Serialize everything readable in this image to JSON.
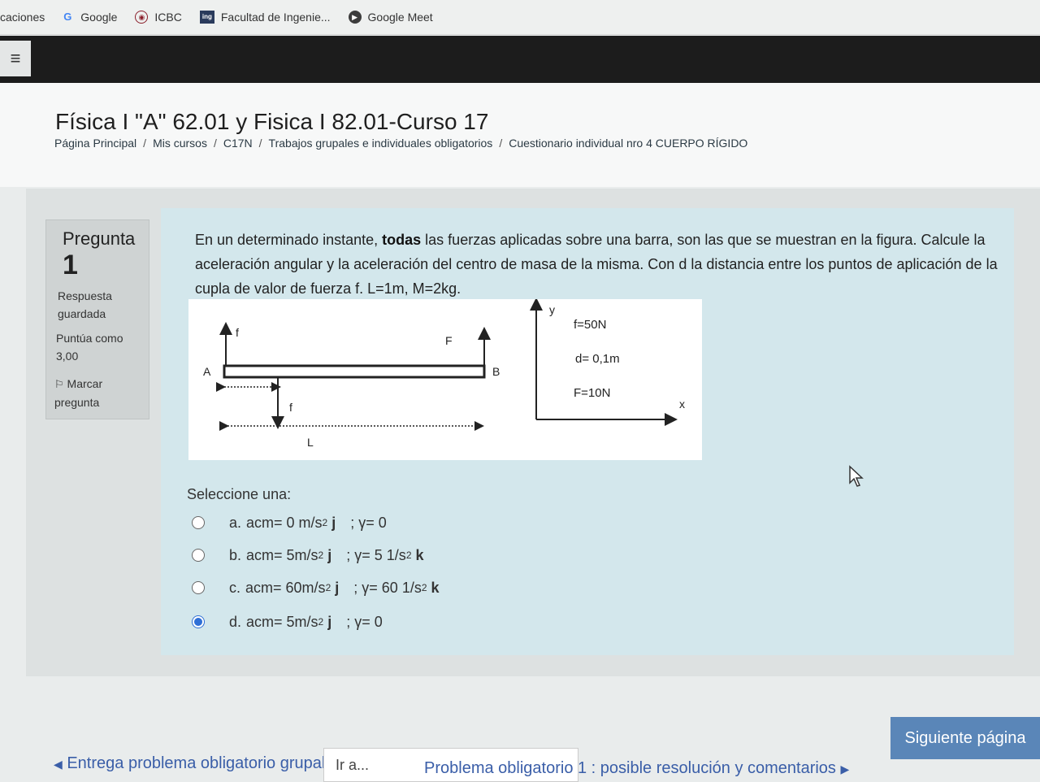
{
  "bookmarks": [
    {
      "label": "caciones",
      "icon": ""
    },
    {
      "label": "Google",
      "icon": "google-icon"
    },
    {
      "label": "ICBC",
      "icon": "icbc-icon"
    },
    {
      "label": "Facultad de Ingenie...",
      "icon": "ing-icon"
    },
    {
      "label": "Google Meet",
      "icon": "meet-icon"
    }
  ],
  "header": {
    "course_title": "Física I \"A\" 62.01 y Fisica I 82.01-Curso 17",
    "breadcrumb": [
      "Página Principal",
      "Mis cursos",
      "C17N",
      "Trabajos grupales e individuales obligatorios",
      "Cuestionario individual nro 4 CUERPO RÍGIDO"
    ]
  },
  "question_info": {
    "label": "Pregunta",
    "number": "1",
    "state_line1": "Respuesta",
    "state_line2": "guardada",
    "grade_line1": "Puntúa como",
    "grade_line2": "3,00",
    "flag_line1": "Marcar",
    "flag_line2": "pregunta"
  },
  "question": {
    "text_pre": "En un determinado instante, ",
    "text_bold": "todas",
    "text_post": " las fuerzas aplicadas sobre una barra, son las que se muestran en la figura. Calcule la aceleración angular y la aceleración del centro de masa de la misma. Con d la distancia entre los puntos de aplicación de la cupla de valor de fuerza f. L=1m, M=2kg.",
    "figure": {
      "label_f_top": "f",
      "label_F": "F",
      "label_A": "A",
      "label_B": "B",
      "label_f_bottom": "f",
      "label_L": "L",
      "axis_y": "y",
      "axis_x": "x",
      "given_f": "f=50N",
      "given_d": "d= 0,1m",
      "given_F": "F=10N"
    },
    "prompt": "Seleccione una:",
    "options": [
      {
        "letter": "a.",
        "acm_pre": "acm= 0 m/s",
        "exp": "2",
        "unit": "j",
        "gamma": "; γ= 0",
        "gamma_exp": "",
        "gamma_unit": "",
        "checked": false
      },
      {
        "letter": "b.",
        "acm_pre": "acm= 5m/s",
        "exp": "2",
        "unit": "j",
        "gamma": "; γ= 5 1/s",
        "gamma_exp": "2",
        "gamma_unit": "k",
        "checked": false
      },
      {
        "letter": "c.",
        "acm_pre": "acm= 60m/s",
        "exp": "2",
        "unit": "j",
        "gamma": "; γ= 60 1/s",
        "gamma_exp": "2",
        "gamma_unit": "k",
        "checked": false
      },
      {
        "letter": "d.",
        "acm_pre": "acm= 5m/s",
        "exp": "2",
        "unit": "j",
        "gamma": "; γ= 0",
        "gamma_exp": "",
        "gamma_unit": "",
        "checked": true
      }
    ]
  },
  "footer": {
    "next_button": "Siguiente página",
    "prev_link": "Entrega problema obligatorio grupal",
    "jump_label": "Ir a...",
    "next_link": "Problema obligatorio 1 : posible resolución y comentarios"
  },
  "colors": {
    "accent": "#2f6fd6",
    "link": "#3a5ea8",
    "next_button": "#5a86b8"
  }
}
